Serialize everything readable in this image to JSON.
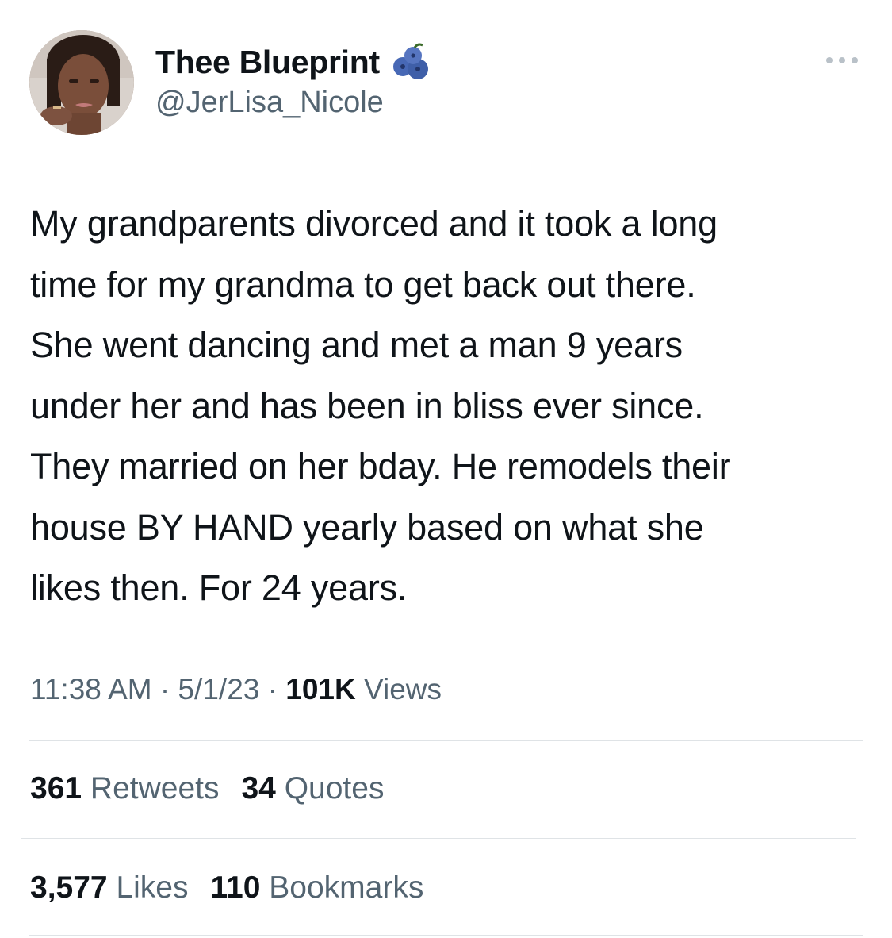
{
  "author": {
    "display_name": "Thee Blueprint",
    "handle": "@JerLisa_Nicole",
    "name_emoji": "blueberries-emoji",
    "avatar": "profile-photo"
  },
  "more_icon": "more-options-icon",
  "tweet": {
    "text": "My grandparents divorced and it took a long\ntime for my grandma to get back out there.\nShe went dancing and met a man 9 years\nunder her and has been in bliss ever since.\nThey married on her bday. He remodels their\nhouse BY HAND yearly based on what she\nlikes then. For 24 years."
  },
  "meta": {
    "time": "11:38 AM",
    "sep1": " · ",
    "date": "5/1/23",
    "sep2": " · ",
    "views_count": "101K",
    "views_label": " Views"
  },
  "engagement": {
    "retweets_count": "361",
    "retweets_label": " Retweets",
    "quotes_count": "34",
    "quotes_label": " Quotes",
    "likes_count": "3,577",
    "likes_label": " Likes",
    "bookmarks_count": "110",
    "bookmarks_label": " Bookmarks"
  },
  "colors": {
    "text_primary": "#0f1419",
    "text_secondary": "#536471",
    "divider": "#dfe3e6",
    "blueberry": "#3f5fa8"
  }
}
